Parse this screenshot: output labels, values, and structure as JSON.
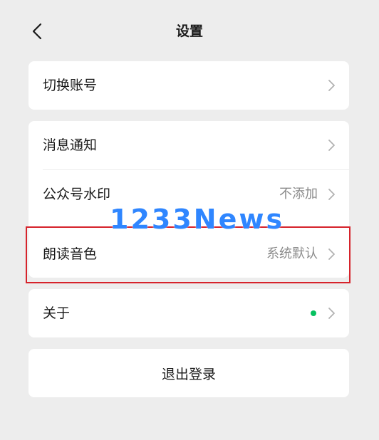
{
  "header": {
    "title": "设置"
  },
  "groups": {
    "account": {
      "switch_account": "切换账号"
    },
    "notify": {
      "message_notification": "消息通知",
      "official_watermark": {
        "label": "公众号水印",
        "value": "不添加"
      }
    },
    "voice": {
      "label": "朗读音色",
      "value": "系统默认"
    },
    "about": {
      "label": "关于"
    },
    "logout": {
      "label": "退出登录"
    }
  },
  "watermark_text": "1233News",
  "colors": {
    "background": "#ededed",
    "card": "#ffffff",
    "accent_dot": "#07c160",
    "highlight_border": "#d6232b",
    "watermark": "#2f86ff"
  }
}
